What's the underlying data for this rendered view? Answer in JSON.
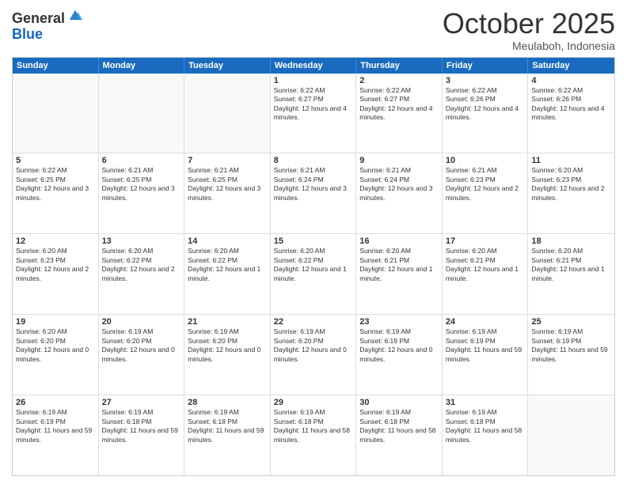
{
  "header": {
    "logo_general": "General",
    "logo_blue": "Blue",
    "title": "October 2025",
    "subtitle": "Meulaboh, Indonesia"
  },
  "days": [
    "Sunday",
    "Monday",
    "Tuesday",
    "Wednesday",
    "Thursday",
    "Friday",
    "Saturday"
  ],
  "weeks": [
    [
      {
        "day": "",
        "empty": true
      },
      {
        "day": "",
        "empty": true
      },
      {
        "day": "",
        "empty": true
      },
      {
        "day": "1",
        "sunrise": "Sunrise: 6:22 AM",
        "sunset": "Sunset: 6:27 PM",
        "daylight": "Daylight: 12 hours and 4 minutes."
      },
      {
        "day": "2",
        "sunrise": "Sunrise: 6:22 AM",
        "sunset": "Sunset: 6:27 PM",
        "daylight": "Daylight: 12 hours and 4 minutes."
      },
      {
        "day": "3",
        "sunrise": "Sunrise: 6:22 AM",
        "sunset": "Sunset: 6:26 PM",
        "daylight": "Daylight: 12 hours and 4 minutes."
      },
      {
        "day": "4",
        "sunrise": "Sunrise: 6:22 AM",
        "sunset": "Sunset: 6:26 PM",
        "daylight": "Daylight: 12 hours and 4 minutes."
      }
    ],
    [
      {
        "day": "5",
        "sunrise": "Sunrise: 6:22 AM",
        "sunset": "Sunset: 6:25 PM",
        "daylight": "Daylight: 12 hours and 3 minutes."
      },
      {
        "day": "6",
        "sunrise": "Sunrise: 6:21 AM",
        "sunset": "Sunset: 6:25 PM",
        "daylight": "Daylight: 12 hours and 3 minutes."
      },
      {
        "day": "7",
        "sunrise": "Sunrise: 6:21 AM",
        "sunset": "Sunset: 6:25 PM",
        "daylight": "Daylight: 12 hours and 3 minutes."
      },
      {
        "day": "8",
        "sunrise": "Sunrise: 6:21 AM",
        "sunset": "Sunset: 6:24 PM",
        "daylight": "Daylight: 12 hours and 3 minutes."
      },
      {
        "day": "9",
        "sunrise": "Sunrise: 6:21 AM",
        "sunset": "Sunset: 6:24 PM",
        "daylight": "Daylight: 12 hours and 3 minutes."
      },
      {
        "day": "10",
        "sunrise": "Sunrise: 6:21 AM",
        "sunset": "Sunset: 6:23 PM",
        "daylight": "Daylight: 12 hours and 2 minutes."
      },
      {
        "day": "11",
        "sunrise": "Sunrise: 6:20 AM",
        "sunset": "Sunset: 6:23 PM",
        "daylight": "Daylight: 12 hours and 2 minutes."
      }
    ],
    [
      {
        "day": "12",
        "sunrise": "Sunrise: 6:20 AM",
        "sunset": "Sunset: 6:23 PM",
        "daylight": "Daylight: 12 hours and 2 minutes."
      },
      {
        "day": "13",
        "sunrise": "Sunrise: 6:20 AM",
        "sunset": "Sunset: 6:22 PM",
        "daylight": "Daylight: 12 hours and 2 minutes."
      },
      {
        "day": "14",
        "sunrise": "Sunrise: 6:20 AM",
        "sunset": "Sunset: 6:22 PM",
        "daylight": "Daylight: 12 hours and 1 minute."
      },
      {
        "day": "15",
        "sunrise": "Sunrise: 6:20 AM",
        "sunset": "Sunset: 6:22 PM",
        "daylight": "Daylight: 12 hours and 1 minute."
      },
      {
        "day": "16",
        "sunrise": "Sunrise: 6:20 AM",
        "sunset": "Sunset: 6:21 PM",
        "daylight": "Daylight: 12 hours and 1 minute."
      },
      {
        "day": "17",
        "sunrise": "Sunrise: 6:20 AM",
        "sunset": "Sunset: 6:21 PM",
        "daylight": "Daylight: 12 hours and 1 minute."
      },
      {
        "day": "18",
        "sunrise": "Sunrise: 6:20 AM",
        "sunset": "Sunset: 6:21 PM",
        "daylight": "Daylight: 12 hours and 1 minute."
      }
    ],
    [
      {
        "day": "19",
        "sunrise": "Sunrise: 6:20 AM",
        "sunset": "Sunset: 6:20 PM",
        "daylight": "Daylight: 12 hours and 0 minutes."
      },
      {
        "day": "20",
        "sunrise": "Sunrise: 6:19 AM",
        "sunset": "Sunset: 6:20 PM",
        "daylight": "Daylight: 12 hours and 0 minutes."
      },
      {
        "day": "21",
        "sunrise": "Sunrise: 6:19 AM",
        "sunset": "Sunset: 6:20 PM",
        "daylight": "Daylight: 12 hours and 0 minutes."
      },
      {
        "day": "22",
        "sunrise": "Sunrise: 6:19 AM",
        "sunset": "Sunset: 6:20 PM",
        "daylight": "Daylight: 12 hours and 0 minutes."
      },
      {
        "day": "23",
        "sunrise": "Sunrise: 6:19 AM",
        "sunset": "Sunset: 6:19 PM",
        "daylight": "Daylight: 12 hours and 0 minutes."
      },
      {
        "day": "24",
        "sunrise": "Sunrise: 6:19 AM",
        "sunset": "Sunset: 6:19 PM",
        "daylight": "Daylight: 11 hours and 59 minutes."
      },
      {
        "day": "25",
        "sunrise": "Sunrise: 6:19 AM",
        "sunset": "Sunset: 6:19 PM",
        "daylight": "Daylight: 11 hours and 59 minutes."
      }
    ],
    [
      {
        "day": "26",
        "sunrise": "Sunrise: 6:19 AM",
        "sunset": "Sunset: 6:19 PM",
        "daylight": "Daylight: 11 hours and 59 minutes."
      },
      {
        "day": "27",
        "sunrise": "Sunrise: 6:19 AM",
        "sunset": "Sunset: 6:18 PM",
        "daylight": "Daylight: 11 hours and 59 minutes."
      },
      {
        "day": "28",
        "sunrise": "Sunrise: 6:19 AM",
        "sunset": "Sunset: 6:18 PM",
        "daylight": "Daylight: 11 hours and 59 minutes."
      },
      {
        "day": "29",
        "sunrise": "Sunrise: 6:19 AM",
        "sunset": "Sunset: 6:18 PM",
        "daylight": "Daylight: 11 hours and 58 minutes."
      },
      {
        "day": "30",
        "sunrise": "Sunrise: 6:19 AM",
        "sunset": "Sunset: 6:18 PM",
        "daylight": "Daylight: 11 hours and 58 minutes."
      },
      {
        "day": "31",
        "sunrise": "Sunrise: 6:19 AM",
        "sunset": "Sunset: 6:18 PM",
        "daylight": "Daylight: 11 hours and 58 minutes."
      },
      {
        "day": "",
        "empty": true
      }
    ]
  ]
}
